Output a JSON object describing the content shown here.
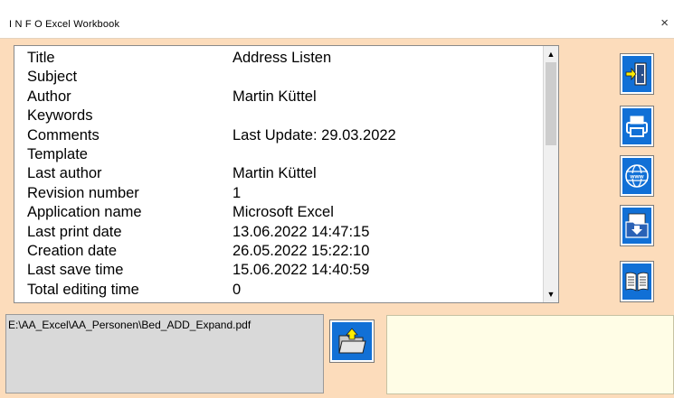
{
  "window": {
    "title": "I N F O  Excel Workbook",
    "close_glyph": "×"
  },
  "properties": [
    {
      "label": "Title",
      "value": "Address Listen"
    },
    {
      "label": "Subject",
      "value": ""
    },
    {
      "label": "Author",
      "value": "Martin Küttel"
    },
    {
      "label": "Keywords",
      "value": ""
    },
    {
      "label": "Comments",
      "value": "Last Update: 29.03.2022"
    },
    {
      "label": "Template",
      "value": ""
    },
    {
      "label": "Last author",
      "value": "Martin Küttel"
    },
    {
      "label": "Revision number",
      "value": "1"
    },
    {
      "label": "Application name",
      "value": "Microsoft Excel"
    },
    {
      "label": "Last print date",
      "value": "13.06.2022 14:47:15"
    },
    {
      "label": "Creation date",
      "value": "26.05.2022 15:22:10"
    },
    {
      "label": "Last save time",
      "value": "15.06.2022 14:40:59"
    },
    {
      "label": "Total editing time",
      "value": "0"
    }
  ],
  "scrollbar": {
    "up": "▲",
    "down": "▼"
  },
  "side_buttons": [
    {
      "name": "exit-button",
      "icon": "exit-door-icon"
    },
    {
      "name": "print-button",
      "icon": "printer-icon"
    },
    {
      "name": "web-button",
      "icon": "www-globe-icon"
    },
    {
      "name": "save-pdf-button",
      "icon": "folder-download-icon"
    },
    {
      "name": "book-button",
      "icon": "book-icon"
    }
  ],
  "path_field": {
    "value": "E:\\AA_Excel\\AA_Personen\\Bed_ADD_Expand.pdf"
  },
  "open_button": {
    "icon": "folder-upload-icon"
  },
  "notes_field": {
    "value": ""
  },
  "colors": {
    "background": "#fcdcbb",
    "button_blue": "#1170d6",
    "notes_bg": "#fffde6"
  }
}
